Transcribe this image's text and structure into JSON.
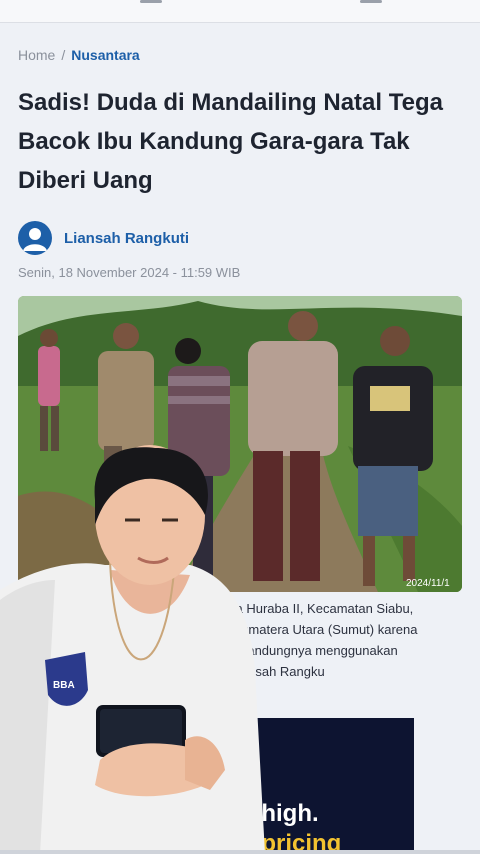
{
  "breadcrumb": {
    "home": "Home",
    "separator": "/",
    "current": "Nusantara"
  },
  "article": {
    "title": "Sadis! Duda di Mandailing Natal Tega Bacok Ibu Kandung Gara-gara Tak Diberi Uang",
    "author": "Liansah Rangkuti",
    "date": "Senin, 18 November 2024 - 11:59 WIB",
    "photo_stamp": "2024/11/1",
    "body_lines": [
      "rga Desa Huraba II, Kecamatan Siabu,",
      "dina) Sumatera Utara (Sumut) karena",
      "u kandungnya menggunakan",
      "iansah Rangku"
    ]
  },
  "ad": {
    "line1": "d high.",
    "line2": "d pricing"
  },
  "overlay": {
    "shirt_badge": "BBA"
  },
  "icons": {
    "author": "user-avatar-icon"
  },
  "colors": {
    "accent": "#1d5fa8",
    "text": "#1e2430",
    "muted": "#8b919c",
    "ad_bg": "#0d1431",
    "ad_highlight": "#f2c230"
  }
}
